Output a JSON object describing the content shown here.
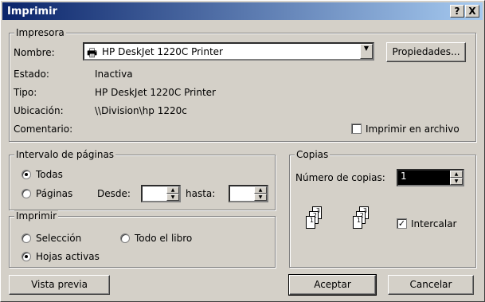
{
  "title": "Imprimir",
  "title_help": "?",
  "title_close": "X",
  "printer": {
    "legend": "Impresora",
    "name_label": "Nombre:",
    "name_value": "HP DeskJet 1220C Printer",
    "properties_button": "Propiedades...",
    "status_label": "Estado:",
    "status_value": "Inactiva",
    "type_label": "Tipo:",
    "type_value": "HP DeskJet 1220C Printer",
    "location_label": "Ubicación:",
    "location_value": "\\\\Division\\hp 1220c",
    "comment_label": "Comentario:",
    "print_to_file": "Imprimir en archivo"
  },
  "range": {
    "legend": "Intervalo de páginas",
    "all": "Todas",
    "pages": "Páginas",
    "from": "Desde:",
    "to": "hasta:",
    "from_value": "",
    "to_value": ""
  },
  "print_what": {
    "legend": "Imprimir",
    "selection": "Selección",
    "whole_book": "Todo el libro",
    "active_sheets": "Hojas activas"
  },
  "copies": {
    "legend": "Copias",
    "count_label": "Número de copias:",
    "count_value": "1",
    "collate": "Intercalar",
    "collate_checked": true,
    "page_numbers": [
      "1",
      "2",
      "3"
    ]
  },
  "buttons": {
    "preview": "Vista previa",
    "ok": "Aceptar",
    "cancel": "Cancelar"
  }
}
